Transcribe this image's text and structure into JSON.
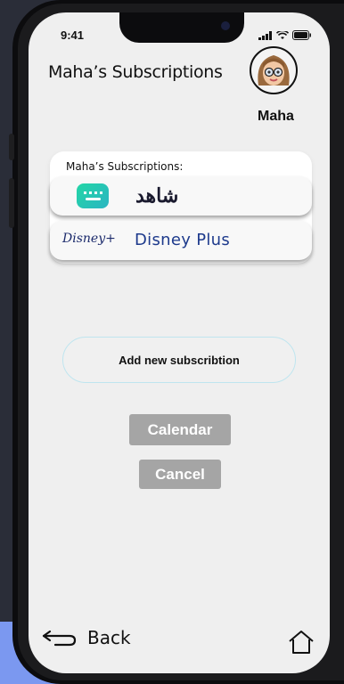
{
  "status": {
    "time": "9:41"
  },
  "header": {
    "title": "Maha’s Subscriptions",
    "user_name": "Maha"
  },
  "subscriptions": {
    "heading": "Maha’s Subscriptions:",
    "items": [
      {
        "name": "شاهد",
        "icon": "shahid-logo"
      },
      {
        "name": "Disney Plus",
        "logo_text": "Disney+",
        "icon": "disney-plus-logo"
      }
    ]
  },
  "actions": {
    "add_label": "Add new subscribtion",
    "calendar_label": "Calendar",
    "cancel_label": "Cancel"
  },
  "nav": {
    "back_label": "Back",
    "back_icon": "back-arrow-icon",
    "home_icon": "home-icon"
  },
  "colors": {
    "screen_bg": "#efefef",
    "button_gray": "#a5a5a5",
    "shahid_green": "#23d6a6",
    "disney_blue": "#1d3a8c",
    "add_border": "#bfe5ef"
  }
}
